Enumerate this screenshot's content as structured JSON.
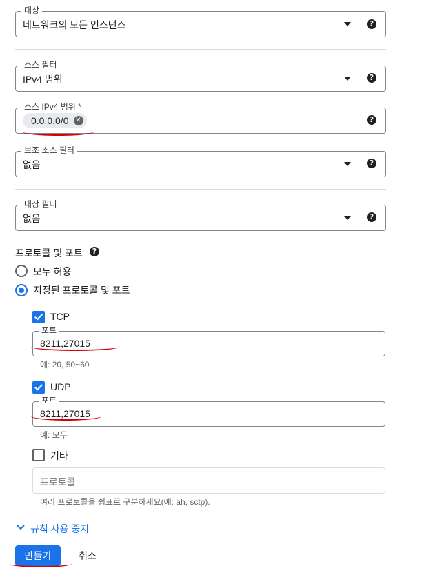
{
  "target": {
    "label": "대상",
    "value": "네트워크의 모든 인스턴스"
  },
  "source_filter": {
    "label": "소스 필터",
    "value": "IPv4 범위"
  },
  "source_ipv4": {
    "label": "소스 IPv4 범위 *",
    "chip": "0.0.0.0/0"
  },
  "secondary_source_filter": {
    "label": "보조 소스 필터",
    "value": "없음"
  },
  "target_filter": {
    "label": "대상 필터",
    "value": "없음"
  },
  "protocols": {
    "heading": "프로토콜 및 포트",
    "allow_all": "모두 허용",
    "specified": "지정된 프로토콜 및 포트",
    "tcp": {
      "label": "TCP",
      "checked": true,
      "port_label": "포트",
      "port_value": "8211,27015",
      "hint": "예: 20, 50~60"
    },
    "udp": {
      "label": "UDP",
      "checked": true,
      "port_label": "포트",
      "port_value": "8211,27015",
      "hint": "예: 모두"
    },
    "other": {
      "label": "기타",
      "checked": false,
      "placeholder": "프로토콜",
      "hint": "여러 프로토콜을 쉼표로 구분하세요(예: ah, sctp)."
    }
  },
  "disable_rule": "규칙 사용 중지",
  "actions": {
    "create": "만들기",
    "cancel": "취소"
  },
  "colors": {
    "accent": "#1a73e8",
    "annotation": "#d60000"
  }
}
